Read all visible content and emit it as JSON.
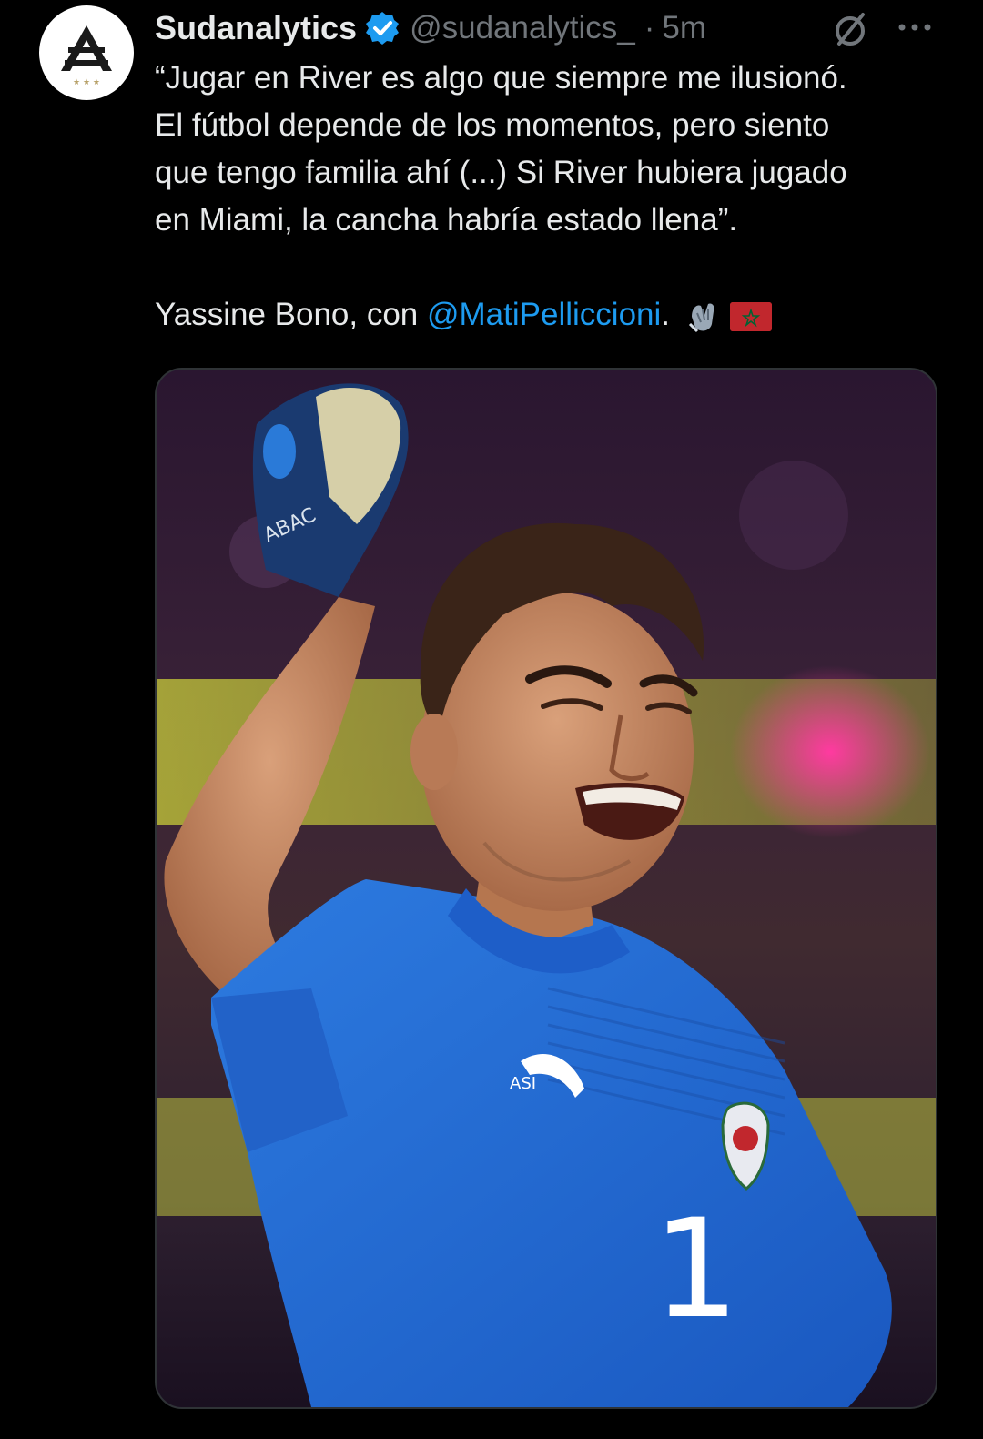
{
  "tweet": {
    "author": {
      "display_name": "Sudanalytics",
      "handle": "@sudanalytics_",
      "verified": true,
      "avatar_icon": "sudanalytics-logo-icon"
    },
    "separator": "·",
    "time": "5m",
    "text": {
      "quote_lines": [
        "“Jugar en River es algo que siempre me ilusionó.",
        "El fútbol depende de los momentos, pero siento",
        "que tengo familia ahí (...) Si River hubiera jugado",
        "en Miami, la cancha habría estado llena”."
      ],
      "credit_prefix": "Yassine Bono, con ",
      "mention": "@MatiPelliccioni",
      "credit_suffix": ".",
      "emojis": [
        "gloves-icon",
        "morocco-flag-icon"
      ]
    },
    "media": {
      "type": "photo",
      "shirt_lettering": "ASI",
      "shirt_number": "1",
      "glove_lettering": "ABAC"
    },
    "actions": [
      "grok-icon",
      "more-options-icon"
    ]
  },
  "colors": {
    "background": "#000000",
    "text_primary": "#e7e9ea",
    "text_secondary": "#71767b",
    "link": "#1d9bf0",
    "verified_badge": "#1d9bf0"
  }
}
